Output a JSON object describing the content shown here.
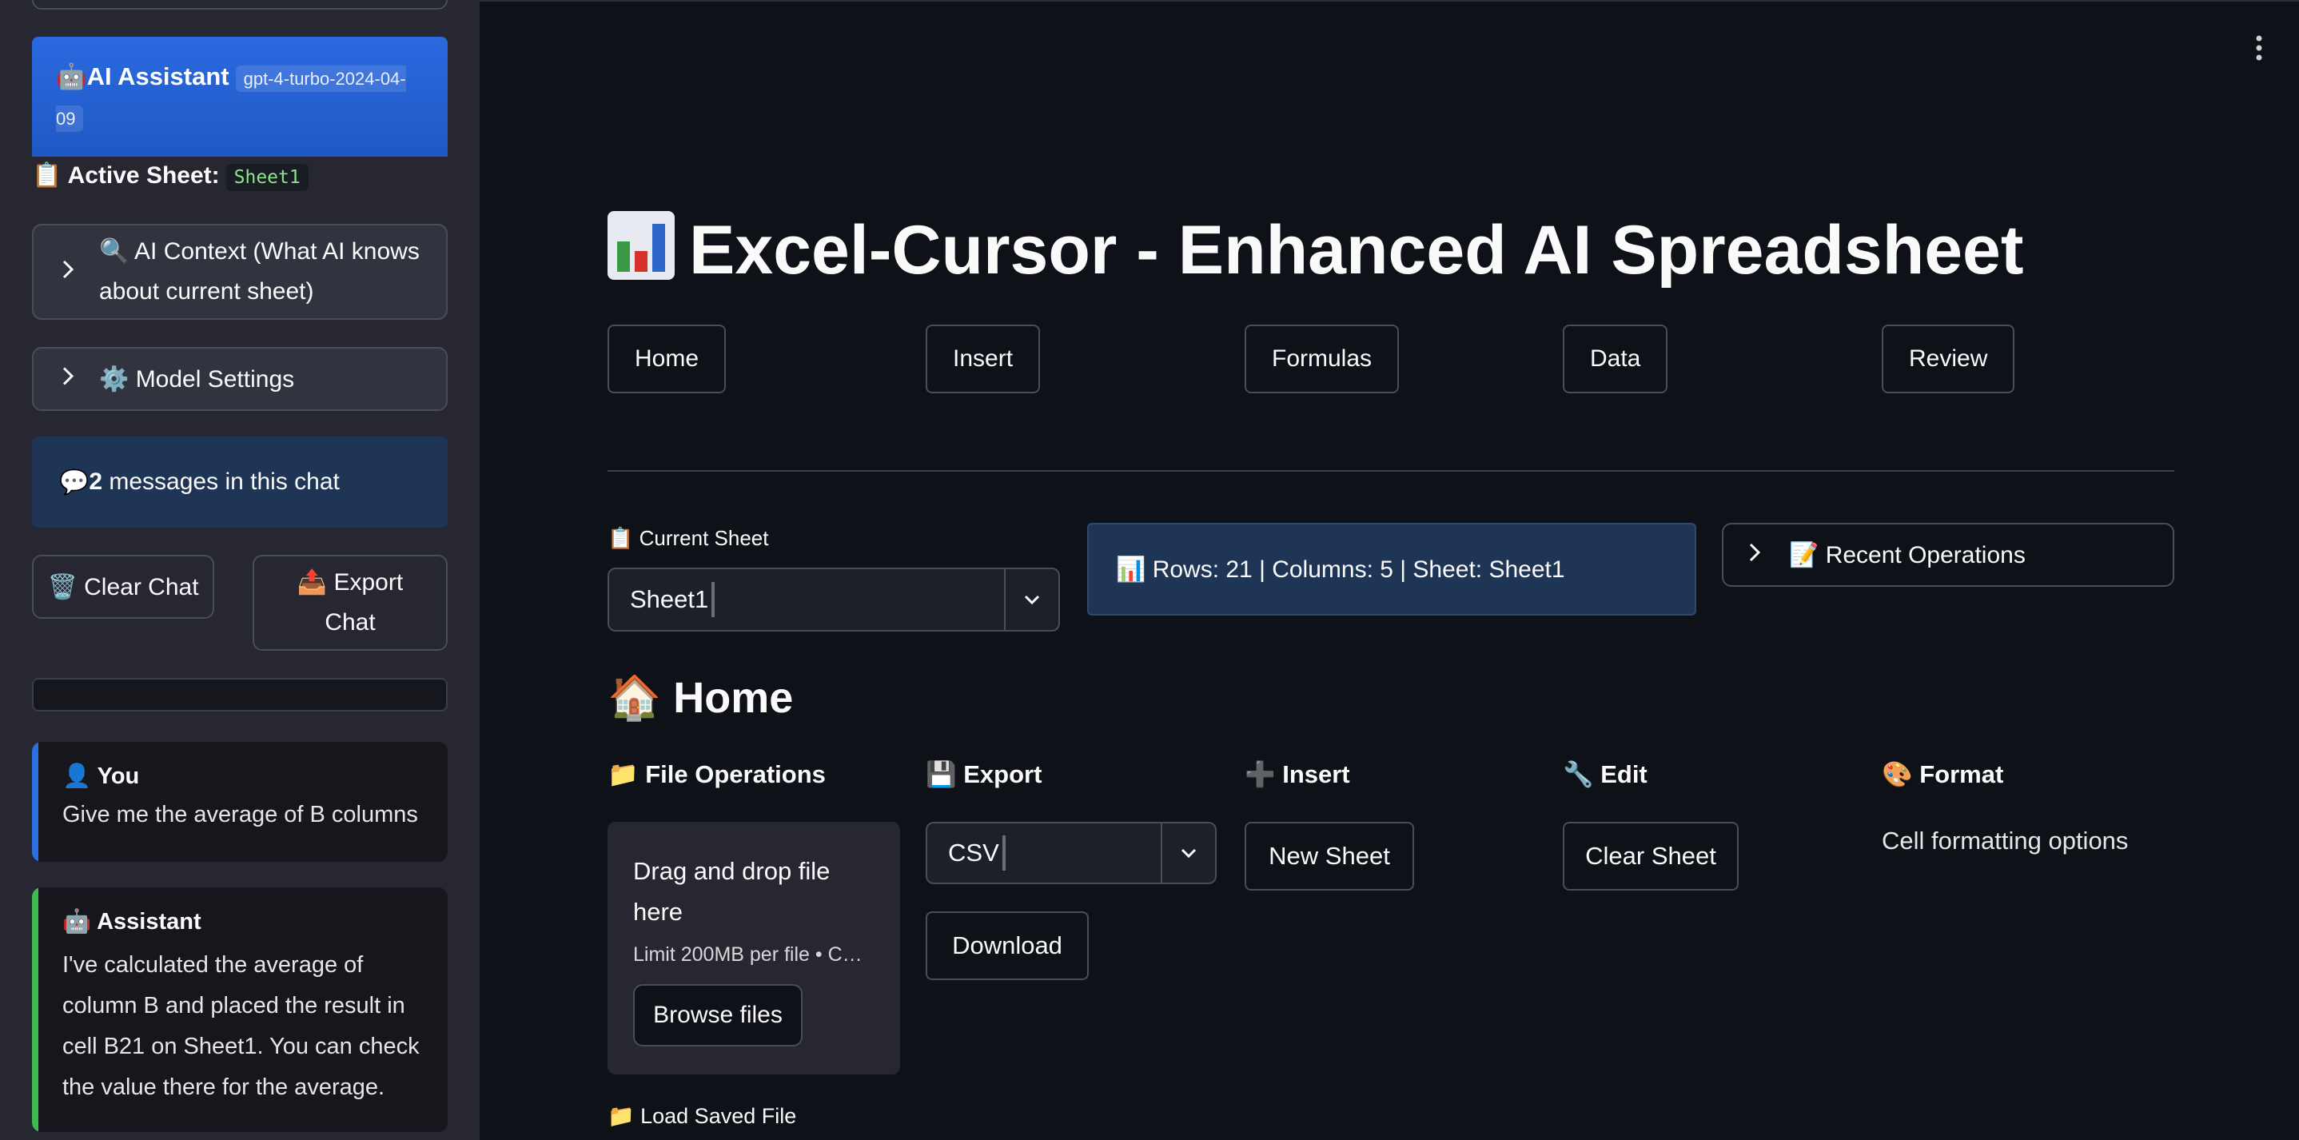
{
  "sidebar": {
    "ai_title": "🤖AI Assistant",
    "model": "gpt-4-turbo-2024-04-09",
    "active_sheet_label": "📋 Active Sheet:",
    "active_sheet_value": "Sheet1",
    "context_expander": "🔍 AI Context (What AI knows about current sheet)",
    "model_settings_expander": "⚙️ Model Settings",
    "message_count_prefix": "💬 ",
    "message_count": "2",
    "message_count_suffix": " messages in this chat",
    "clear_chat": "🗑️ Clear Chat",
    "export_chat": "📤 Export Chat",
    "chat": [
      {
        "role": "👤 You",
        "text": "Give me the average of B columns"
      },
      {
        "role": "🤖 Assistant",
        "text": "I've calculated the average of column B and placed the result in cell B21 on Sheet1. You can check the value there for the average."
      }
    ]
  },
  "main": {
    "title": "Excel-Cursor - Enhanced AI Spreadsheet",
    "tabs": [
      "Home",
      "Insert",
      "Formulas",
      "Data",
      "Review"
    ],
    "current_sheet_label": "📋 Current Sheet",
    "current_sheet_value": "Sheet1",
    "sheet_info": "📊 Rows: 21 | Columns: 5 | Sheet: Sheet1",
    "recent_operations": "📝 Recent Operations",
    "section_title": "🏠 Home",
    "columns": {
      "file_ops": "📁 File Operations",
      "export": "💾 Export",
      "insert": "➕ Insert",
      "edit": "🔧 Edit",
      "format": "🎨 Format"
    },
    "dropzone_title": "Drag and drop file here",
    "dropzone_limit": "Limit 200MB per file • C…",
    "browse_files": "Browse files",
    "export_format": "CSV",
    "download": "Download",
    "new_sheet": "New Sheet",
    "clear_sheet": "Clear Sheet",
    "format_text": "Cell formatting options",
    "load_saved_file": "📁 Load Saved File",
    "menu_icon": "kebab-menu-icon"
  },
  "colors": {
    "background": "#0e1117",
    "sidebar": "#262730",
    "accent_blue": "#2a6ae0",
    "info_bg": "#1f3556",
    "user_bar": "#2d6fe0",
    "assistant_bar": "#3fb950"
  }
}
